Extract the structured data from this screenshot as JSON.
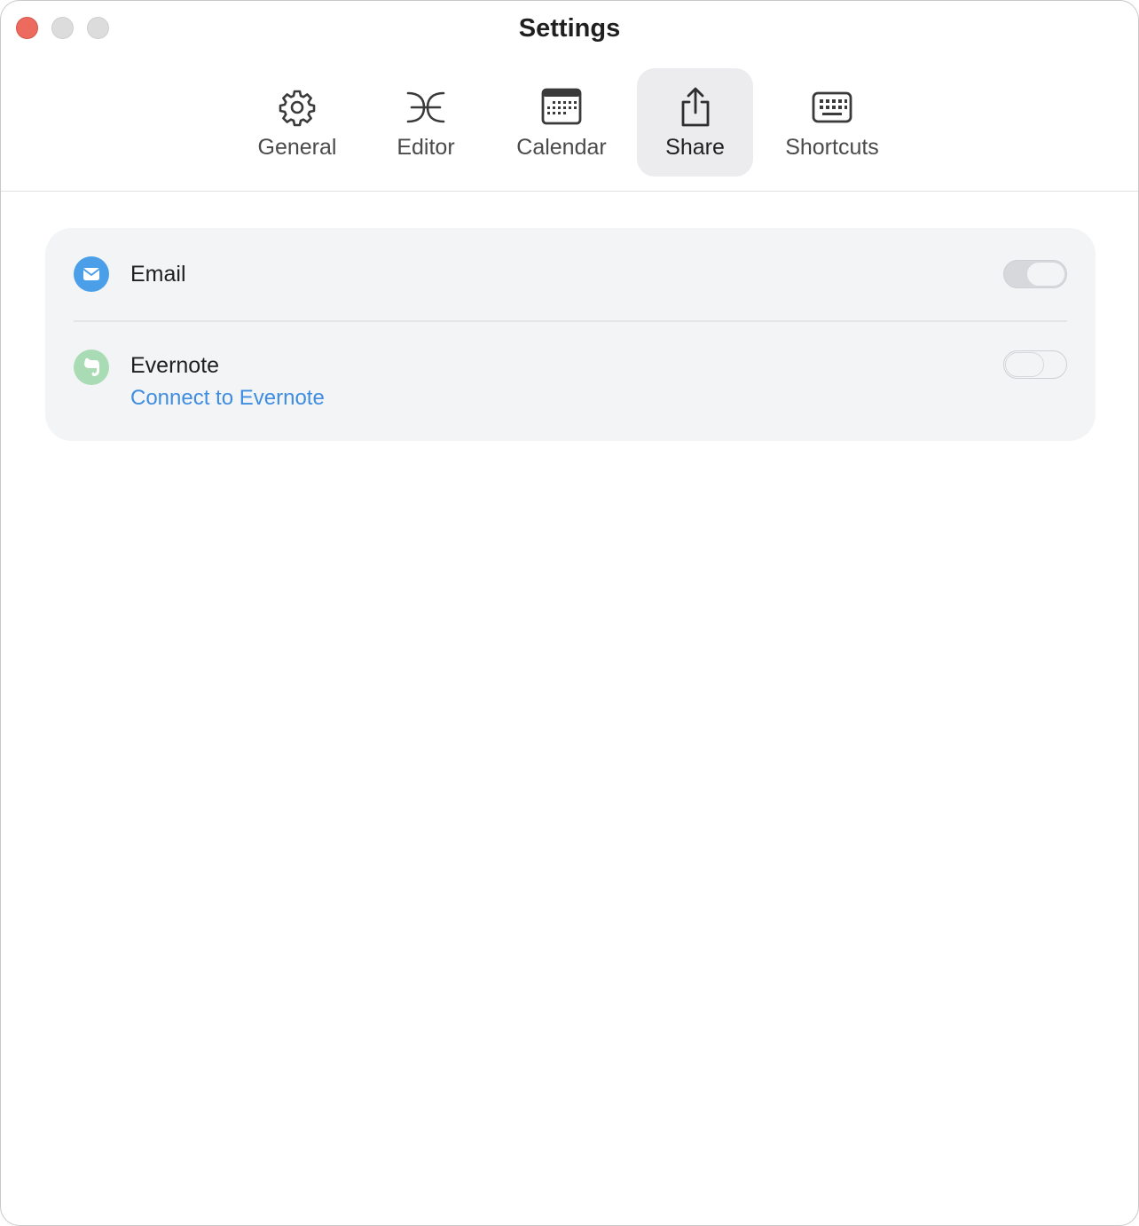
{
  "window": {
    "title": "Settings"
  },
  "tabs": [
    {
      "label": "General",
      "icon": "gear-icon"
    },
    {
      "label": "Editor",
      "icon": "editor-glyph-icon"
    },
    {
      "label": "Calendar",
      "icon": "calendar-icon"
    },
    {
      "label": "Share",
      "icon": "share-icon",
      "active": true
    },
    {
      "label": "Shortcuts",
      "icon": "keyboard-icon"
    }
  ],
  "share": {
    "email": {
      "label": "Email",
      "icon": "envelope-icon",
      "icon_color": "#4a9fe8",
      "enabled": false
    },
    "evernote": {
      "label": "Evernote",
      "link": "Connect to Evernote",
      "icon": "evernote-icon",
      "icon_color": "#a9dcb4",
      "enabled": false
    }
  },
  "colors": {
    "link": "#3f8de0",
    "close_button": "#ec6a5e"
  }
}
